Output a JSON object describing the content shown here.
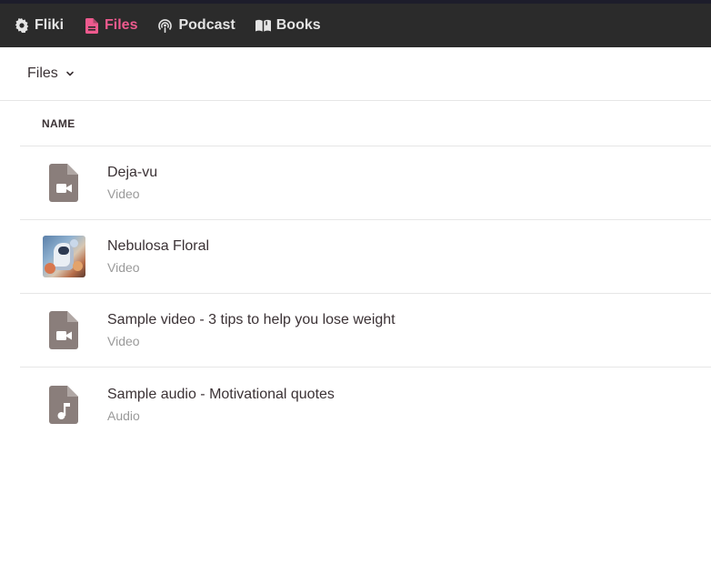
{
  "nav": {
    "items": [
      {
        "label": "Fliki",
        "icon": "gear-icon",
        "active": false
      },
      {
        "label": "Files",
        "icon": "file-icon",
        "active": true
      },
      {
        "label": "Podcast",
        "icon": "podcast-icon",
        "active": false
      },
      {
        "label": "Books",
        "icon": "book-icon",
        "active": false
      }
    ],
    "active_color": "#ee5a8e",
    "bar_color": "#2b2b2b"
  },
  "subheader": {
    "dropdown_label": "Files"
  },
  "table": {
    "column_header": "NAME",
    "rows": [
      {
        "name": "Deja-vu",
        "type": "Video",
        "thumb": "video-file-icon"
      },
      {
        "name": "Nebulosa Floral",
        "type": "Video",
        "thumb": "astronaut-thumbnail"
      },
      {
        "name": "Sample video - 3 tips to help you lose weight",
        "type": "Video",
        "thumb": "video-file-icon"
      },
      {
        "name": "Sample audio - Motivational quotes",
        "type": "Audio",
        "thumb": "audio-file-icon"
      }
    ]
  }
}
